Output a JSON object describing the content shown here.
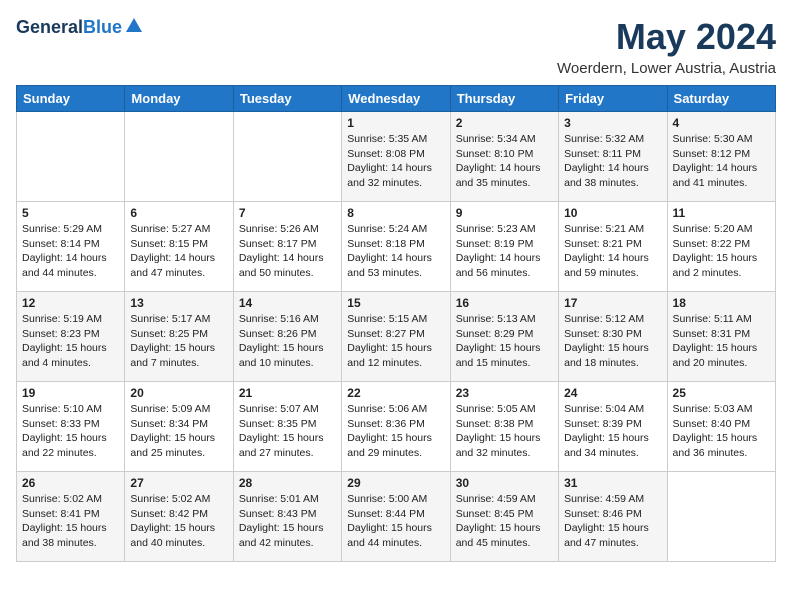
{
  "header": {
    "logo_line1": "General",
    "logo_line2": "Blue",
    "month_title": "May 2024",
    "location": "Woerdern, Lower Austria, Austria"
  },
  "days_of_week": [
    "Sunday",
    "Monday",
    "Tuesday",
    "Wednesday",
    "Thursday",
    "Friday",
    "Saturday"
  ],
  "weeks": [
    [
      {
        "day": "",
        "sunrise": "",
        "sunset": "",
        "daylight": ""
      },
      {
        "day": "",
        "sunrise": "",
        "sunset": "",
        "daylight": ""
      },
      {
        "day": "",
        "sunrise": "",
        "sunset": "",
        "daylight": ""
      },
      {
        "day": "1",
        "sunrise": "Sunrise: 5:35 AM",
        "sunset": "Sunset: 8:08 PM",
        "daylight": "Daylight: 14 hours and 32 minutes."
      },
      {
        "day": "2",
        "sunrise": "Sunrise: 5:34 AM",
        "sunset": "Sunset: 8:10 PM",
        "daylight": "Daylight: 14 hours and 35 minutes."
      },
      {
        "day": "3",
        "sunrise": "Sunrise: 5:32 AM",
        "sunset": "Sunset: 8:11 PM",
        "daylight": "Daylight: 14 hours and 38 minutes."
      },
      {
        "day": "4",
        "sunrise": "Sunrise: 5:30 AM",
        "sunset": "Sunset: 8:12 PM",
        "daylight": "Daylight: 14 hours and 41 minutes."
      }
    ],
    [
      {
        "day": "5",
        "sunrise": "Sunrise: 5:29 AM",
        "sunset": "Sunset: 8:14 PM",
        "daylight": "Daylight: 14 hours and 44 minutes."
      },
      {
        "day": "6",
        "sunrise": "Sunrise: 5:27 AM",
        "sunset": "Sunset: 8:15 PM",
        "daylight": "Daylight: 14 hours and 47 minutes."
      },
      {
        "day": "7",
        "sunrise": "Sunrise: 5:26 AM",
        "sunset": "Sunset: 8:17 PM",
        "daylight": "Daylight: 14 hours and 50 minutes."
      },
      {
        "day": "8",
        "sunrise": "Sunrise: 5:24 AM",
        "sunset": "Sunset: 8:18 PM",
        "daylight": "Daylight: 14 hours and 53 minutes."
      },
      {
        "day": "9",
        "sunrise": "Sunrise: 5:23 AM",
        "sunset": "Sunset: 8:19 PM",
        "daylight": "Daylight: 14 hours and 56 minutes."
      },
      {
        "day": "10",
        "sunrise": "Sunrise: 5:21 AM",
        "sunset": "Sunset: 8:21 PM",
        "daylight": "Daylight: 14 hours and 59 minutes."
      },
      {
        "day": "11",
        "sunrise": "Sunrise: 5:20 AM",
        "sunset": "Sunset: 8:22 PM",
        "daylight": "Daylight: 15 hours and 2 minutes."
      }
    ],
    [
      {
        "day": "12",
        "sunrise": "Sunrise: 5:19 AM",
        "sunset": "Sunset: 8:23 PM",
        "daylight": "Daylight: 15 hours and 4 minutes."
      },
      {
        "day": "13",
        "sunrise": "Sunrise: 5:17 AM",
        "sunset": "Sunset: 8:25 PM",
        "daylight": "Daylight: 15 hours and 7 minutes."
      },
      {
        "day": "14",
        "sunrise": "Sunrise: 5:16 AM",
        "sunset": "Sunset: 8:26 PM",
        "daylight": "Daylight: 15 hours and 10 minutes."
      },
      {
        "day": "15",
        "sunrise": "Sunrise: 5:15 AM",
        "sunset": "Sunset: 8:27 PM",
        "daylight": "Daylight: 15 hours and 12 minutes."
      },
      {
        "day": "16",
        "sunrise": "Sunrise: 5:13 AM",
        "sunset": "Sunset: 8:29 PM",
        "daylight": "Daylight: 15 hours and 15 minutes."
      },
      {
        "day": "17",
        "sunrise": "Sunrise: 5:12 AM",
        "sunset": "Sunset: 8:30 PM",
        "daylight": "Daylight: 15 hours and 18 minutes."
      },
      {
        "day": "18",
        "sunrise": "Sunrise: 5:11 AM",
        "sunset": "Sunset: 8:31 PM",
        "daylight": "Daylight: 15 hours and 20 minutes."
      }
    ],
    [
      {
        "day": "19",
        "sunrise": "Sunrise: 5:10 AM",
        "sunset": "Sunset: 8:33 PM",
        "daylight": "Daylight: 15 hours and 22 minutes."
      },
      {
        "day": "20",
        "sunrise": "Sunrise: 5:09 AM",
        "sunset": "Sunset: 8:34 PM",
        "daylight": "Daylight: 15 hours and 25 minutes."
      },
      {
        "day": "21",
        "sunrise": "Sunrise: 5:07 AM",
        "sunset": "Sunset: 8:35 PM",
        "daylight": "Daylight: 15 hours and 27 minutes."
      },
      {
        "day": "22",
        "sunrise": "Sunrise: 5:06 AM",
        "sunset": "Sunset: 8:36 PM",
        "daylight": "Daylight: 15 hours and 29 minutes."
      },
      {
        "day": "23",
        "sunrise": "Sunrise: 5:05 AM",
        "sunset": "Sunset: 8:38 PM",
        "daylight": "Daylight: 15 hours and 32 minutes."
      },
      {
        "day": "24",
        "sunrise": "Sunrise: 5:04 AM",
        "sunset": "Sunset: 8:39 PM",
        "daylight": "Daylight: 15 hours and 34 minutes."
      },
      {
        "day": "25",
        "sunrise": "Sunrise: 5:03 AM",
        "sunset": "Sunset: 8:40 PM",
        "daylight": "Daylight: 15 hours and 36 minutes."
      }
    ],
    [
      {
        "day": "26",
        "sunrise": "Sunrise: 5:02 AM",
        "sunset": "Sunset: 8:41 PM",
        "daylight": "Daylight: 15 hours and 38 minutes."
      },
      {
        "day": "27",
        "sunrise": "Sunrise: 5:02 AM",
        "sunset": "Sunset: 8:42 PM",
        "daylight": "Daylight: 15 hours and 40 minutes."
      },
      {
        "day": "28",
        "sunrise": "Sunrise: 5:01 AM",
        "sunset": "Sunset: 8:43 PM",
        "daylight": "Daylight: 15 hours and 42 minutes."
      },
      {
        "day": "29",
        "sunrise": "Sunrise: 5:00 AM",
        "sunset": "Sunset: 8:44 PM",
        "daylight": "Daylight: 15 hours and 44 minutes."
      },
      {
        "day": "30",
        "sunrise": "Sunrise: 4:59 AM",
        "sunset": "Sunset: 8:45 PM",
        "daylight": "Daylight: 15 hours and 45 minutes."
      },
      {
        "day": "31",
        "sunrise": "Sunrise: 4:59 AM",
        "sunset": "Sunset: 8:46 PM",
        "daylight": "Daylight: 15 hours and 47 minutes."
      },
      {
        "day": "",
        "sunrise": "",
        "sunset": "",
        "daylight": ""
      }
    ]
  ]
}
